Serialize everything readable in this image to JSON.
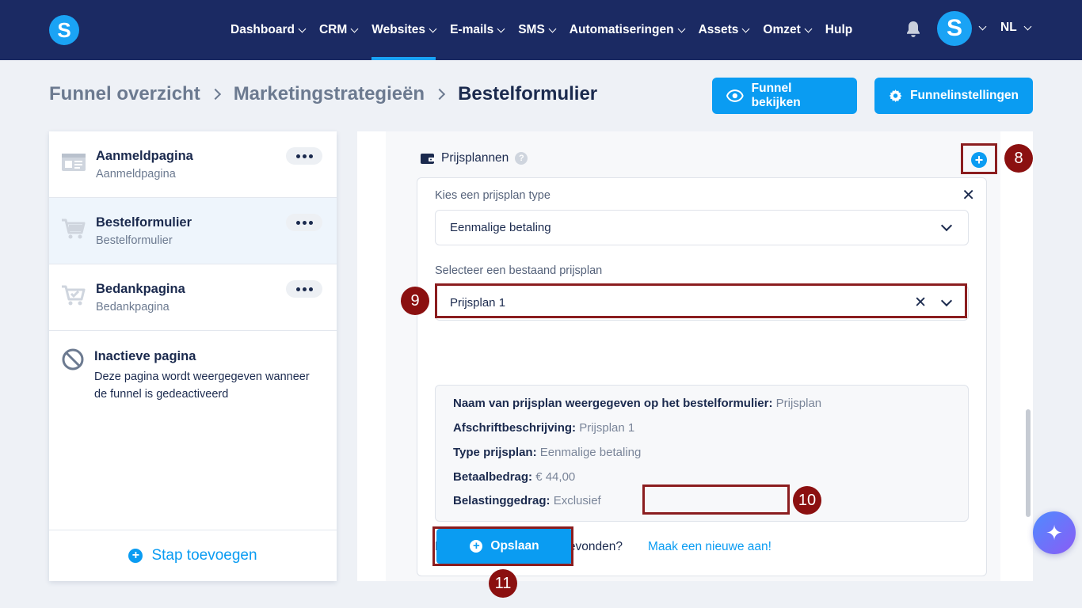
{
  "nav": {
    "items": [
      {
        "label": "Dashboard",
        "active": false
      },
      {
        "label": "CRM",
        "active": false
      },
      {
        "label": "Websites",
        "active": true
      },
      {
        "label": "E-mails",
        "active": false
      },
      {
        "label": "SMS",
        "active": false
      },
      {
        "label": "Automatiseringen",
        "active": false
      },
      {
        "label": "Assets",
        "active": false
      },
      {
        "label": "Omzet",
        "active": false
      }
    ],
    "help": "Hulp",
    "logo_letter": "S",
    "avatar_letter": "S",
    "language": "NL",
    "accent": "#1aa3f5",
    "background": "#1b2a63"
  },
  "breadcrumb": {
    "items": [
      "Funnel overzicht",
      "Marketingstrategieën"
    ],
    "current": "Bestelformulier"
  },
  "actions": {
    "view_funnel": "Funnel bekijken",
    "funnel_settings": "Funnelinstellingen"
  },
  "steps": [
    {
      "title": "Aanmeldpagina",
      "subtitle": "Aanmeldpagina",
      "icon": "page-icon",
      "selected": false
    },
    {
      "title": "Bestelformulier",
      "subtitle": "Bestelformulier",
      "icon": "cart-icon",
      "selected": true
    },
    {
      "title": "Bedankpagina",
      "subtitle": "Bedankpagina",
      "icon": "cart-check-icon",
      "selected": false
    }
  ],
  "inactive_page": {
    "title": "Inactieve pagina",
    "description": "Deze pagina wordt weergegeven wanneer de funnel is gedeactiveerd"
  },
  "add_step": "Stap toevoegen",
  "pricing": {
    "header": "Prijsplannen",
    "help_symbol": "?",
    "type_label": "Kies een prijsplan type",
    "type_value": "Eenmalige betaling",
    "existing_label": "Selecteer een bestaand prijsplan",
    "existing_value": "Prijsplan 1",
    "details": [
      {
        "label": "Naam van prijsplan weergegeven op het bestelformulier:",
        "value": "Prijsplan"
      },
      {
        "label": "Afschriftbeschrijving:",
        "value": "Prijsplan 1"
      },
      {
        "label": "Type prijsplan:",
        "value": "Eenmalige betaling"
      },
      {
        "label": "Betaalbedrag:",
        "value": "€ 44,00"
      },
      {
        "label": "Belastinggedrag:",
        "value": "Exclusief"
      }
    ],
    "not_found": "Niet het juiste prijsplan gevonden?",
    "create_new": "Maak een nieuwe aan!",
    "save": "Opslaan"
  },
  "markers": [
    "8",
    "9",
    "10",
    "11"
  ],
  "colors": {
    "primary": "#0a9cf2",
    "annotation": "#8b1010"
  }
}
